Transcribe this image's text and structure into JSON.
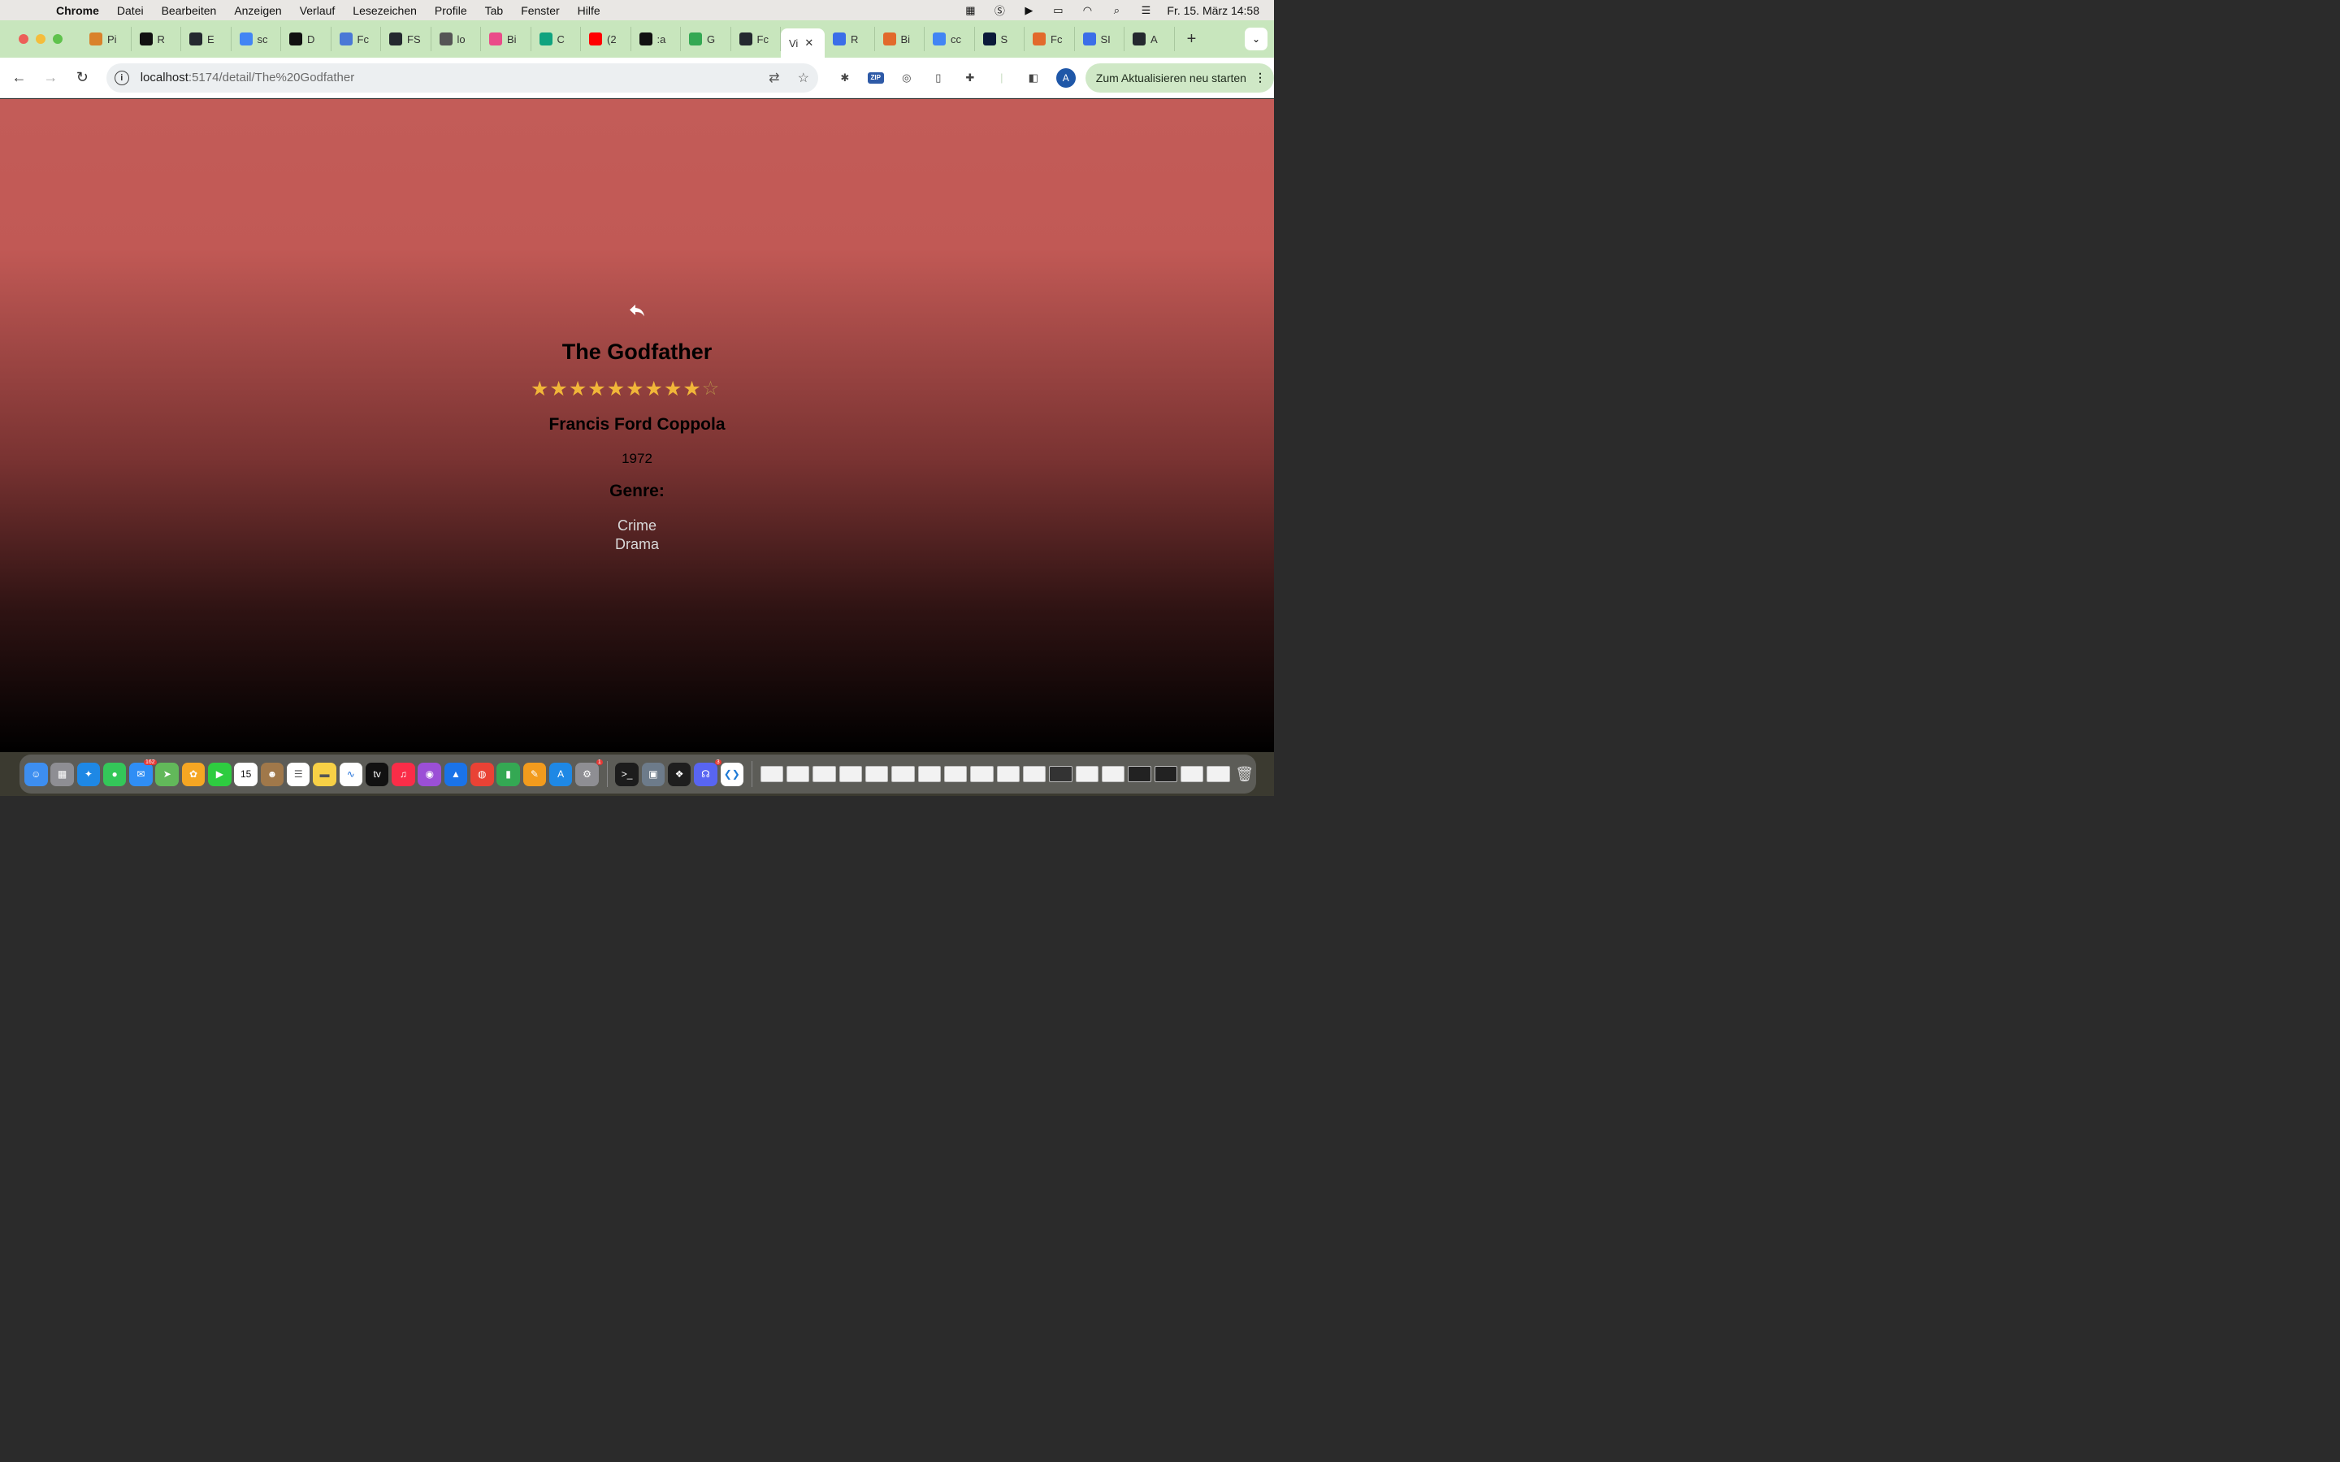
{
  "menubar": {
    "app_name": "Chrome",
    "items": [
      "Datei",
      "Bearbeiten",
      "Anzeigen",
      "Verlauf",
      "Lesezeichen",
      "Profile",
      "Tab",
      "Fenster",
      "Hilfe"
    ],
    "clock": "Fr. 15. März  14:58"
  },
  "tabs": [
    {
      "label": "Pi",
      "color": "#d9822b"
    },
    {
      "label": "R",
      "color": "#111111"
    },
    {
      "label": "E",
      "color": "#24292f"
    },
    {
      "label": "sc",
      "color": "#4285f4"
    },
    {
      "label": "D",
      "color": "#111111"
    },
    {
      "label": "Fc",
      "color": "#4a78d6"
    },
    {
      "label": "FS",
      "color": "#24292f"
    },
    {
      "label": "lo",
      "color": "#555555"
    },
    {
      "label": "Bi",
      "color": "#ea4c89"
    },
    {
      "label": "C",
      "color": "#10a37f"
    },
    {
      "label": "(2",
      "color": "#ff0000"
    },
    {
      "label": ":a",
      "color": "#111111"
    },
    {
      "label": "G",
      "color": "#34a853"
    },
    {
      "label": "Fc",
      "color": "#24292f"
    }
  ],
  "active_tab": {
    "label": "Vi",
    "close": "✕"
  },
  "tabs_after": [
    {
      "label": "R",
      "color": "#3b6ee8"
    },
    {
      "label": "Bi",
      "color": "#e26a2c"
    },
    {
      "label": "cc",
      "color": "#4285f4"
    },
    {
      "label": "S",
      "color": "#0b1a3a"
    },
    {
      "label": "Fc",
      "color": "#e26a2c"
    },
    {
      "label": "SI",
      "color": "#3b6ee8"
    },
    {
      "label": "A",
      "color": "#24292f"
    }
  ],
  "toolbar": {
    "url_host": "localhost",
    "url_path": ":5174/detail/The%20Godfather",
    "update_label": "Zum Aktualisieren neu starten",
    "avatar_letter": "A",
    "zip_label": "ZIP"
  },
  "movie": {
    "title": "The Godfather",
    "rating": 9,
    "rating_max": 10,
    "director": "Francis Ford Coppola",
    "year": "1972",
    "genre_heading": "Genre:",
    "genres": [
      "Crime",
      "Drama"
    ]
  },
  "colors": {
    "page_top": "#c35c58",
    "page_bottom": "#000000",
    "star": "#f1b639",
    "tabstrip": "#c8e6bd"
  },
  "dock": {
    "calendar_day": "15",
    "mail_badge": "162",
    "settings_badge": "1",
    "discord_badge": "3"
  }
}
